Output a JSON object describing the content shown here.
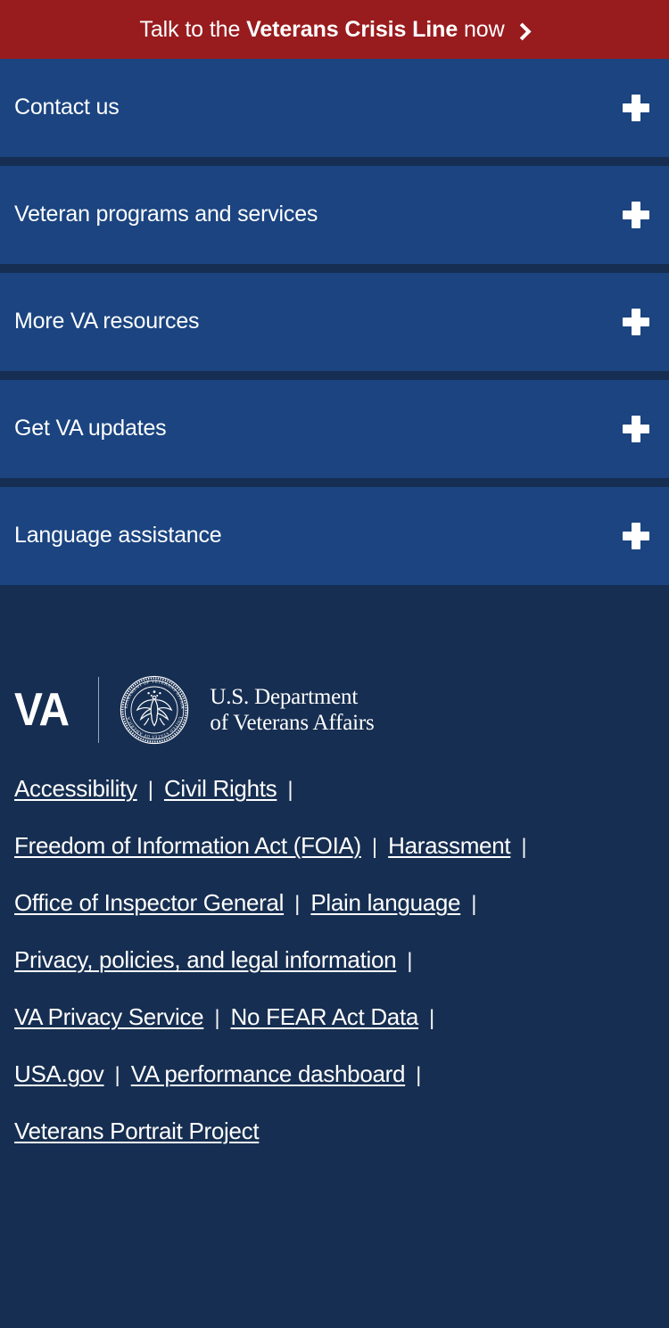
{
  "crisis_banner": {
    "text_lead": "Talk to the ",
    "text_bold": "Veterans Crisis Line",
    "text_tail": " now",
    "chevron_icon": "chevron-right-icon",
    "background_color": "#981b1e"
  },
  "accordion": {
    "expand_icon": "plus-icon",
    "background_color": "#1b4480",
    "items": [
      {
        "label": "Contact us"
      },
      {
        "label": "Veteran programs and services"
      },
      {
        "label": "More VA resources"
      },
      {
        "label": "Get VA updates"
      },
      {
        "label": "Language assistance"
      }
    ]
  },
  "logo": {
    "wordmark": "VA",
    "seal_icon": "va-seal-icon",
    "seal_ring_top_text": "DEPARTMENT OF VETERANS AFFAIRS",
    "seal_ring_bottom_text": "UNITED STATES OF AMERICA",
    "department_line1": "U.S. Department",
    "department_line2": "of Veterans Affairs"
  },
  "footer": {
    "background_color": "#162e51",
    "separator": "|",
    "link_rows": [
      [
        "Accessibility",
        "Civil Rights"
      ],
      [
        "Freedom of Information Act (FOIA)",
        "Harassment"
      ],
      [
        "Office of Inspector General",
        "Plain language"
      ],
      [
        "Privacy, policies, and legal information"
      ],
      [
        "VA Privacy Service",
        "No FEAR Act Data"
      ],
      [
        "USA.gov",
        "VA performance dashboard"
      ],
      [
        "Veterans Portrait Project"
      ]
    ]
  }
}
